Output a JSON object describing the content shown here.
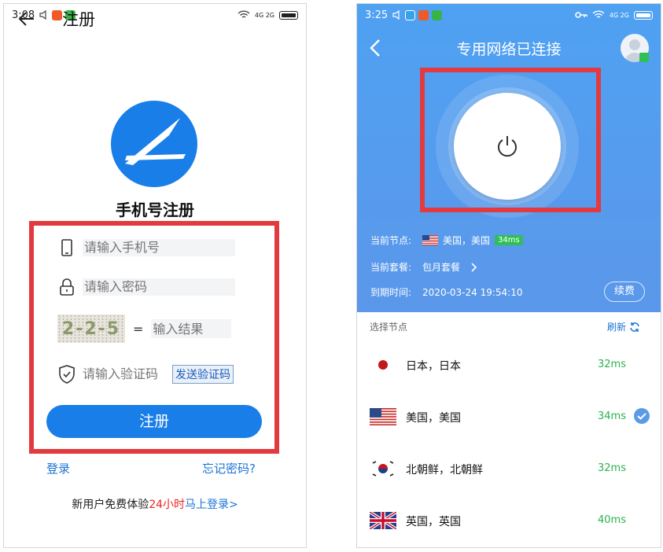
{
  "left": {
    "status": {
      "time": "3:08",
      "net": "4G 2G"
    },
    "appbar": {
      "title": "注册"
    },
    "heading": "手机号注册",
    "fields": {
      "phone_placeholder": "请输入手机号",
      "password_placeholder": "请输入密码",
      "captcha_text": "2-2-5",
      "captcha_equals": "=",
      "captcha_placeholder": "输入结果",
      "code_placeholder": "请输入验证码",
      "send_code": "发送验证码"
    },
    "register_button": "注册",
    "login_link": "登录",
    "forgot_link": "忘记密码?",
    "promo": {
      "prefix": "新用户免费体验",
      "highlight": "24小时",
      "action": "马上登录>"
    }
  },
  "right": {
    "status": {
      "time": "3:25",
      "net": "4G 2G"
    },
    "header_title": "专用网络已连接",
    "current_node": {
      "label": "当前节点:",
      "value": "美国，美国",
      "ping": "34ms"
    },
    "current_plan": {
      "label": "当前套餐:",
      "value": "包月套餐"
    },
    "expiry": {
      "label": "到期时间:",
      "value": "2020-03-24 19:54:10"
    },
    "renew_button": "续费",
    "node_list_title": "选择节点",
    "refresh_label": "刷新",
    "nodes": [
      {
        "name": "日本，日本",
        "ping": "32ms",
        "flag": "jp-flag",
        "selected": false
      },
      {
        "name": "美国，美国",
        "ping": "34ms",
        "flag": "us-flag",
        "selected": true
      },
      {
        "name": "北朝鲜，北朝鲜",
        "ping": "32ms",
        "flag": "kr-flag",
        "selected": false
      },
      {
        "name": "英国，英国",
        "ping": "40ms",
        "flag": "uk-flag",
        "selected": false
      }
    ]
  },
  "colors": {
    "primary_blue": "#1a7ee8",
    "highlight_red": "#e23a3f",
    "ping_green": "#2bb24c",
    "header_blue": "#4fa1f2"
  }
}
